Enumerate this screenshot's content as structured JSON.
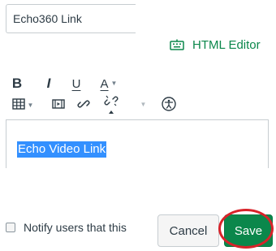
{
  "title_field": {
    "value": "Echo360 Link"
  },
  "editor_toggle": {
    "label": "HTML Editor",
    "icon": "keyboard-icon",
    "color": "#0b874b"
  },
  "toolbar": {
    "bold": "B",
    "italic": "I",
    "underline": "U",
    "text_color": "A",
    "icons": [
      "table-icon",
      "media-icon",
      "link-icon",
      "unlink-icon",
      "accessibility-icon"
    ]
  },
  "editor": {
    "content": "Echo Video Link",
    "selection_color": "#3390ff"
  },
  "notify": {
    "label": "Notify users that this",
    "checked": false
  },
  "actions": {
    "cancel_label": "Cancel",
    "save_label": "Save",
    "save_color": "#0b874b",
    "highlight_color": "#d8232a"
  }
}
